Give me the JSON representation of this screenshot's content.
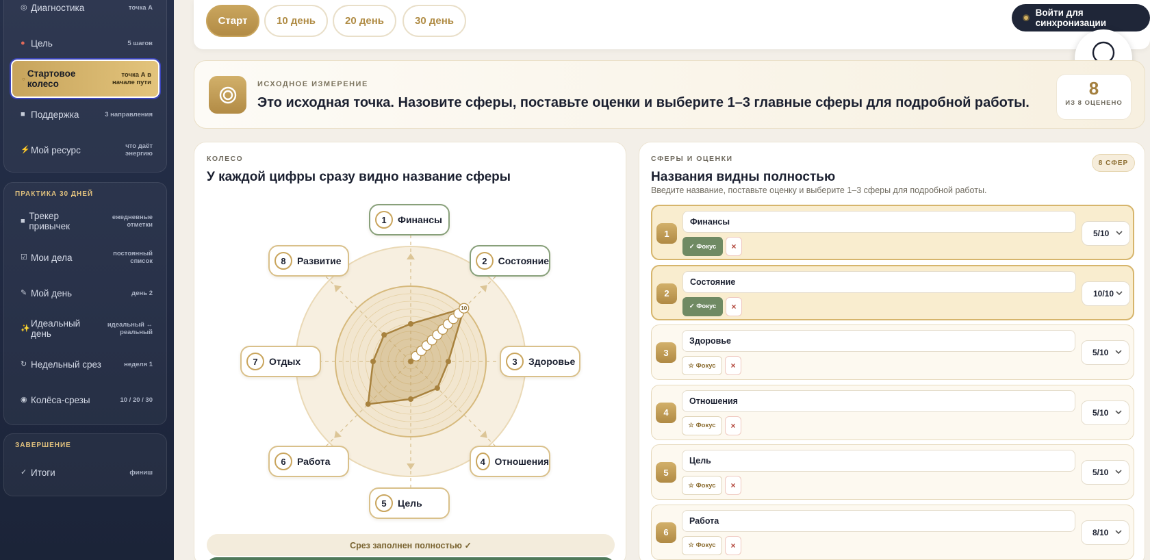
{
  "sidebar": {
    "items": [
      {
        "label": "Диагностика",
        "meta": "точка А",
        "icon": "target-icon"
      },
      {
        "label": "Цель",
        "meta": "5 шагов",
        "icon": "dart-icon"
      },
      {
        "label": "Стартовое колесо",
        "meta": "точка А в начале пути",
        "icon": "circle-icon"
      },
      {
        "label": "Поддержка",
        "meta": "3 направления",
        "icon": "square-icon"
      },
      {
        "label": "Мой ресурс",
        "meta": "что даёт энергию",
        "icon": "bolt-icon"
      }
    ],
    "practice": {
      "title": "ПРАКТИКА 30 ДНЕЙ",
      "items": [
        {
          "label": "Трекер привычек",
          "meta": "ежедневные отметки",
          "icon": "square-icon"
        },
        {
          "label": "Мои дела",
          "meta": "постоянный список",
          "icon": "checkbox-icon"
        },
        {
          "label": "Мой день",
          "meta": "день 2",
          "icon": "pencil-icon"
        },
        {
          "label": "Идеальный день",
          "meta": "идеальный ↔ реальный",
          "icon": "sparkles-icon"
        },
        {
          "label": "Недельный срез",
          "meta": "неделя 1",
          "icon": "refresh-icon"
        },
        {
          "label": "Колёса-срезы",
          "meta": "10 / 20 / 30",
          "icon": "radio-icon"
        }
      ]
    },
    "finish": {
      "title": "ЗАВЕРШЕНИЕ",
      "items": [
        {
          "label": "Итоги",
          "meta": "финиш",
          "icon": "check-icon"
        }
      ]
    }
  },
  "topbar": {
    "tabs": [
      "Старт",
      "10 день",
      "20 день",
      "30 день"
    ],
    "sync_label": "Войти для синхронизации"
  },
  "banner": {
    "kicker": "ИСХОДНОЕ ИЗМЕРЕНИЕ",
    "title": "Это исходная точка. Назовите сферы, поставьте оценки и выберите 1–3 главные сферы для подробной работы.",
    "score": "8",
    "score_label": "ИЗ 8 ОЦЕНЕНО"
  },
  "wheel": {
    "kicker": "КОЛЕСО",
    "title": "У каждой цифры сразу видно название сферы",
    "status": "Срез заполнен полностью ✓",
    "scale_max_label": "10"
  },
  "list": {
    "kicker": "СФЕРЫ И ОЦЕНКИ",
    "badge": "8 СФЕР",
    "title": "Названия видны полностью",
    "subtitle": "Введите название, поставьте оценку и выберите 1–3 сферы для подробной работы.",
    "focus_on_label": "✓ Фокус",
    "focus_off_label": "☆ Фокус",
    "remove_label": "×"
  },
  "spheres": [
    {
      "num": "1",
      "name": "Финансы",
      "score": 5,
      "score_label": "5/10",
      "focus": true
    },
    {
      "num": "2",
      "name": "Состояние",
      "score": 10,
      "score_label": "10/10",
      "focus": true
    },
    {
      "num": "3",
      "name": "Здоровье",
      "score": 5,
      "score_label": "5/10",
      "focus": false
    },
    {
      "num": "4",
      "name": "Отношения",
      "score": 5,
      "score_label": "5/10",
      "focus": false
    },
    {
      "num": "5",
      "name": "Цель",
      "score": 5,
      "score_label": "5/10",
      "focus": false
    },
    {
      "num": "6",
      "name": "Работа",
      "score": 8,
      "score_label": "8/10",
      "focus": false
    },
    {
      "num": "7",
      "name": "Отдых",
      "score": 5,
      "score_label": "5/10",
      "focus": false
    },
    {
      "num": "8",
      "name": "Развитие",
      "score": 5,
      "score_label": "5/10",
      "focus": false
    }
  ],
  "colors": {
    "accent_gold": "#c9a55d",
    "sidebar_bg": "#222b43",
    "focus_green": "#6f8a63",
    "wheel_fill": "#b8924c"
  }
}
